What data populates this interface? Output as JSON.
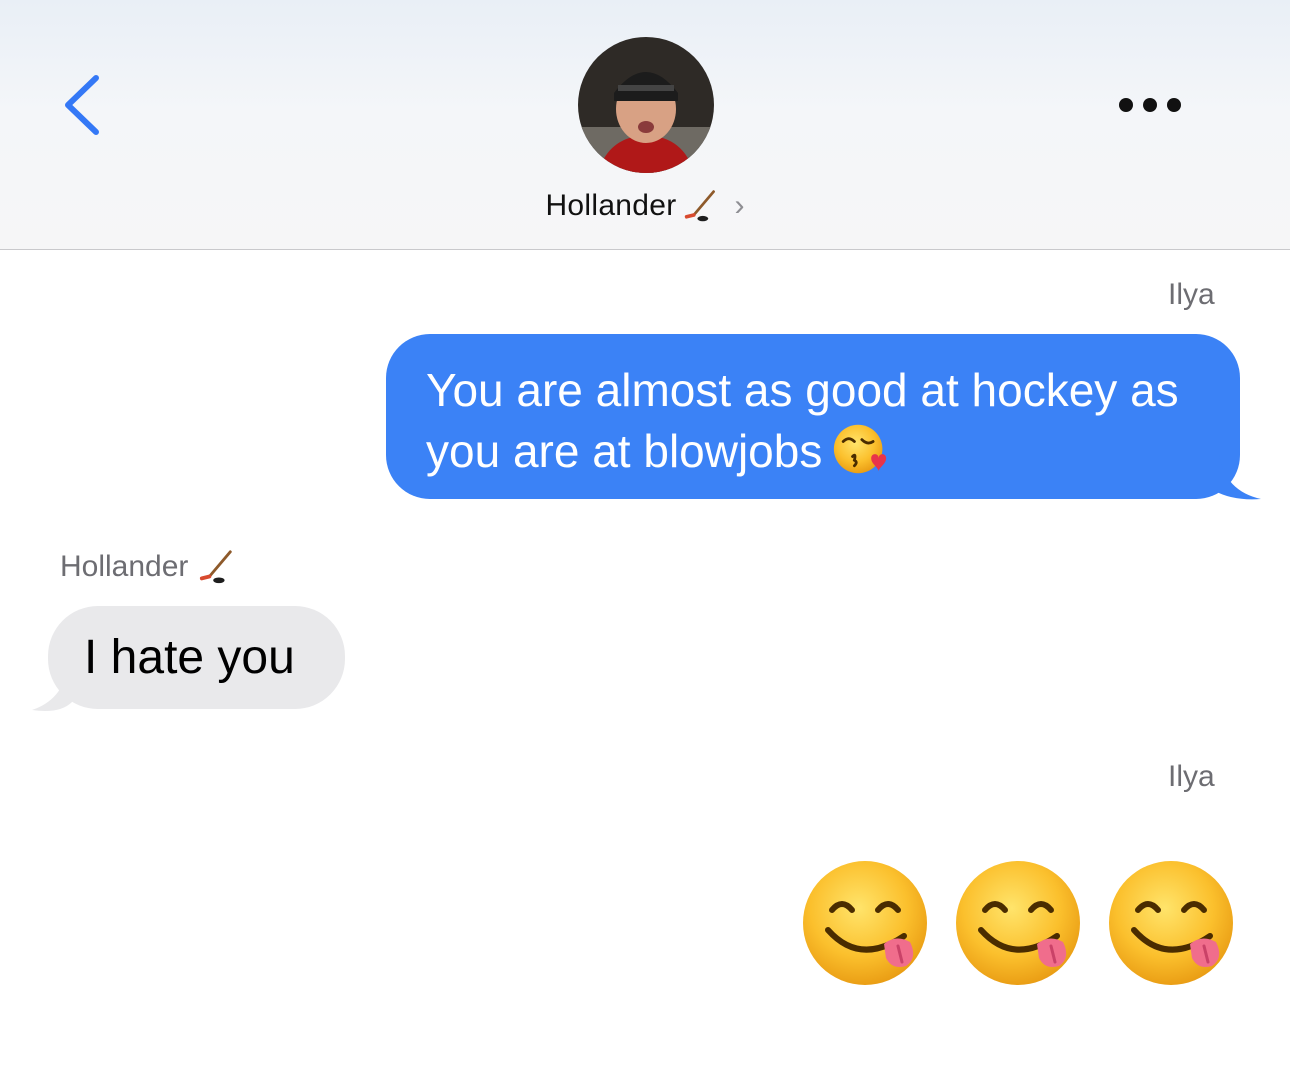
{
  "header": {
    "contact_name": "Hollander",
    "contact_emoji": "hockey-stick-emoji",
    "back_icon": "chevron-left-icon",
    "more_icon": "ellipsis-icon",
    "disclosure": "›"
  },
  "messages": [
    {
      "sender": "Ilya",
      "direction": "outgoing",
      "text": "You are almost as good at hockey as you are at blowjobs",
      "trailing_emoji": "face-blowing-kiss-emoji"
    },
    {
      "sender": "Hollander",
      "direction": "incoming",
      "text": "I hate you"
    },
    {
      "sender": "Ilya",
      "direction": "outgoing",
      "emojis": [
        "face-savoring-food-emoji",
        "face-savoring-food-emoji",
        "face-savoring-food-emoji"
      ]
    }
  ],
  "colors": {
    "accent": "#3b82f6",
    "outgoing_bubble": "#3b82f6",
    "incoming_bubble": "#e9e9eb",
    "back_chevron": "#3478f6"
  }
}
